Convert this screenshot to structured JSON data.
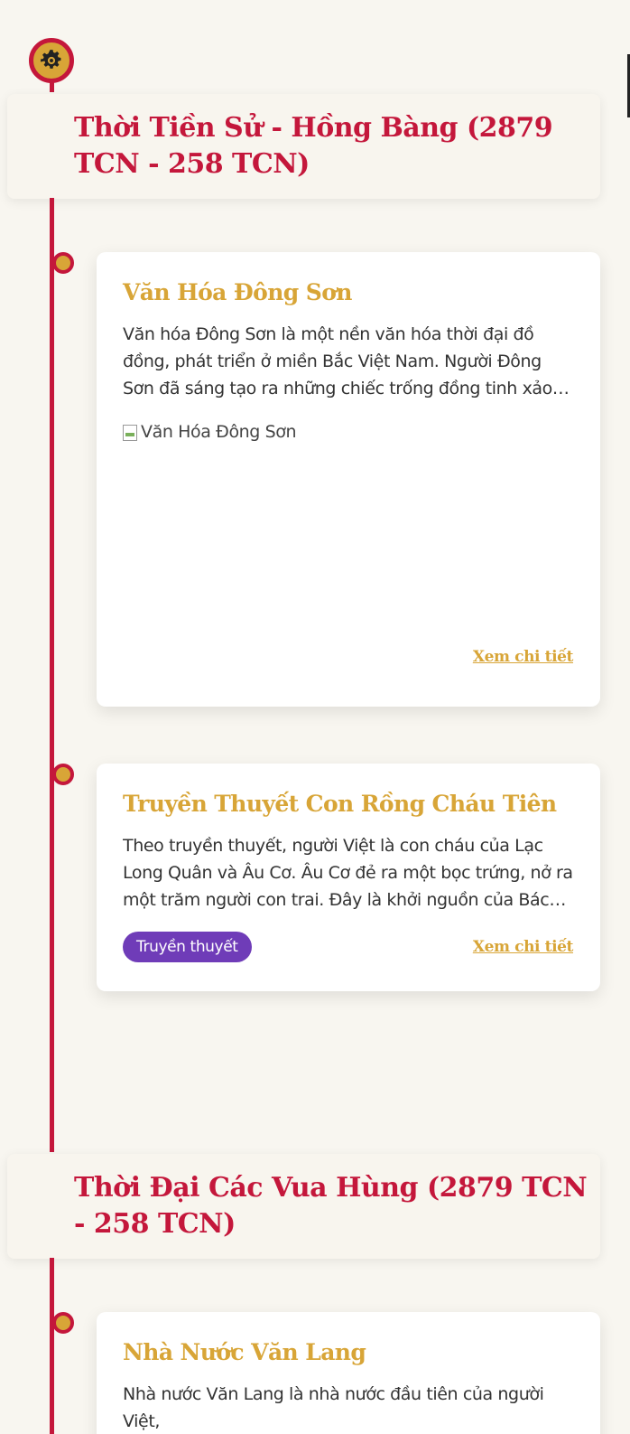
{
  "theme_toggle": {
    "icon": "gear-icon",
    "accent": "#d8a537",
    "border": "#c4173b"
  },
  "periods": [
    {
      "title": "Thời Tiền Sử - Hồng Bàng (2879 TCN - 258 TCN)",
      "events": [
        {
          "title": "Văn Hóa Đông Sơn",
          "description": "Văn hóa Đông Sơn là một nền văn hóa thời đại đồ đồng, phát triển ở miền Bắc Việt Nam. Người Đông Sơn đã sáng tạo ra những chiếc trống đồng tinh xảo với nhiều hoa văn độc đáo.",
          "image_alt": "Văn Hóa Đông Sơn",
          "link_label": "Xem chi tiết"
        },
        {
          "title": "Truyền Thuyết Con Rồng Cháu Tiên",
          "description": "Theo truyền thuyết, người Việt là con cháu của Lạc Long Quân và Âu Cơ. Âu Cơ đẻ ra một bọc trứng, nở ra một trăm người con trai. Đây là khởi nguồn của Bách Việt, tổ tiên của dân tộc.",
          "tag": "Truyền thuyết",
          "link_label": "Xem chi tiết"
        }
      ]
    },
    {
      "title": "Thời Đại Các Vua Hùng (2879 TCN - 258 TCN)",
      "events": [
        {
          "title": "Nhà Nước Văn Lang",
          "description": "Nhà nước Văn Lang là nhà nước đầu tiên của người Việt,"
        }
      ]
    }
  ],
  "colors": {
    "primary_red": "#c4173b",
    "gold": "#d8a537",
    "tag_purple": "#6f3cb8",
    "background": "#f8f6f0"
  }
}
